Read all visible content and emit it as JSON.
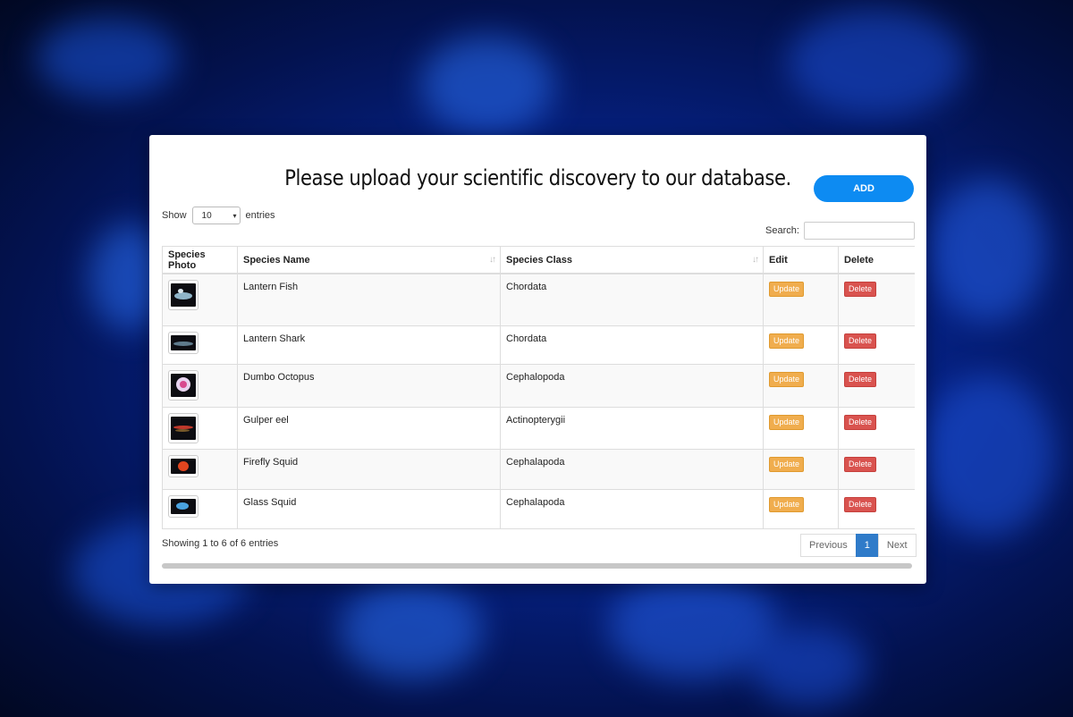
{
  "page": {
    "title": "Please upload your scientific discovery to our database.",
    "add_label": "ADD"
  },
  "controls": {
    "show_label": "Show",
    "entries_value": "10",
    "entries_label": "entries",
    "search_label": "Search:",
    "search_value": ""
  },
  "table": {
    "headers": {
      "photo": "Species Photo",
      "name": "Species Name",
      "class": "Species Class",
      "edit": "Edit",
      "delete": "Delete"
    },
    "update_label": "Update",
    "delete_label": "Delete",
    "rows": [
      {
        "name": "Lantern Fish",
        "class": "Chordata"
      },
      {
        "name": "Lantern Shark",
        "class": "Chordata"
      },
      {
        "name": "Dumbo Octopus",
        "class": "Cephalopoda"
      },
      {
        "name": "Gulper eel",
        "class": "Actinopterygii"
      },
      {
        "name": "Firefly Squid",
        "class": "Cephalapoda"
      },
      {
        "name": "Glass Squid",
        "class": "Cephalapoda"
      }
    ]
  },
  "footer": {
    "info": "Showing 1 to 6 of 6 entries",
    "previous": "Previous",
    "current_page": "1",
    "next": "Next"
  },
  "colors": {
    "add_button": "#0d8bf2",
    "update_badge": "#f0ad4e",
    "delete_badge": "#d9534f",
    "active_page": "#2f7bc9"
  }
}
